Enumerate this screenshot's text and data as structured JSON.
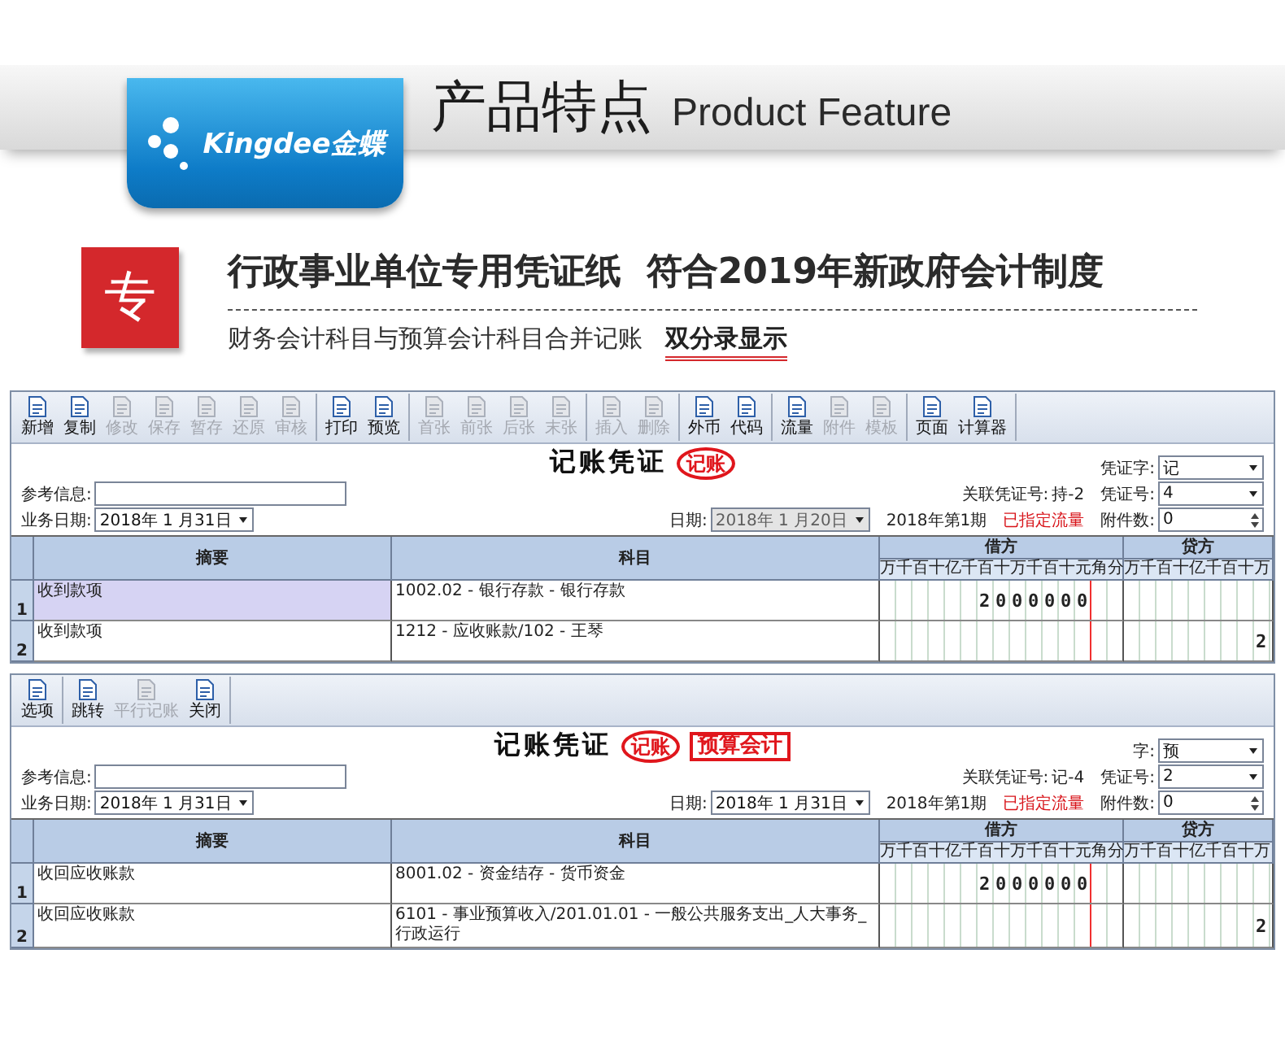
{
  "banner": {
    "logo": "Kingdee金蝶",
    "title": "产品特点",
    "subtitle": "Product Feature"
  },
  "feature": {
    "badge": "专",
    "heading": "行政事业单位专用凭证纸  符合2019年新政府会计制度",
    "description": "财务会计科目与预算会计科目合并记账",
    "highlight": "双分录显示"
  },
  "panes": [
    {
      "toolbar": [
        [
          {
            "label": "新增",
            "disabled": false
          },
          {
            "label": "复制",
            "disabled": false
          },
          {
            "label": "修改",
            "disabled": true
          },
          {
            "label": "保存",
            "disabled": true
          },
          {
            "label": "暂存",
            "disabled": true
          },
          {
            "label": "还原",
            "disabled": true
          },
          {
            "label": "审核",
            "disabled": true
          }
        ],
        [
          {
            "label": "打印",
            "disabled": false
          },
          {
            "label": "预览",
            "disabled": false
          }
        ],
        [
          {
            "label": "首张",
            "disabled": true
          },
          {
            "label": "前张",
            "disabled": true
          },
          {
            "label": "后张",
            "disabled": true
          },
          {
            "label": "末张",
            "disabled": true
          }
        ],
        [
          {
            "label": "插入",
            "disabled": true
          },
          {
            "label": "删除",
            "disabled": true
          }
        ],
        [
          {
            "label": "外币",
            "disabled": false
          },
          {
            "label": "代码",
            "disabled": false
          }
        ],
        [
          {
            "label": "流量",
            "disabled": false
          },
          {
            "label": "附件",
            "disabled": true
          },
          {
            "label": "模板",
            "disabled": true
          }
        ],
        [
          {
            "label": "页面",
            "disabled": false
          },
          {
            "label": "计算器",
            "disabled": false
          }
        ]
      ],
      "title": "记账凭证",
      "stamps": [
        {
          "text": "记账",
          "kind": "circle"
        }
      ],
      "voucher_type": {
        "label": "凭证字:",
        "value": "记",
        "kind": "dropdown",
        "disabled": false
      },
      "reference": {
        "label": "参考信息:",
        "kind": "text",
        "disabled": false
      },
      "related": {
        "label": "关联凭证号:",
        "value": "持-2"
      },
      "number": {
        "label": "凭证号:",
        "value": "4",
        "kind": "dropdown",
        "disabled": false
      },
      "business_date": {
        "label": "业务日期:",
        "value": "2018年 1 月31日",
        "kind": "dropdown",
        "disabled": false
      },
      "date": {
        "label": "日期:",
        "value": "2018年 1 月20日",
        "kind": "dropdown",
        "disabled": true
      },
      "period": "2018年第1期",
      "flow_status": "已指定流量",
      "attachments": {
        "label": "附件数:",
        "value": "0",
        "kind": "spin",
        "disabled": false
      },
      "table": {
        "columns": [
          "摘要",
          "科目",
          "借方",
          "贷方"
        ],
        "debit_units": "万千百十亿千百十万千百十元角分",
        "credit_units": "万千百十亿千百十万",
        "rows": [
          {
            "number": "1",
            "summary": "收到款项",
            "account": "1002.02 - 银行存款 - 银行存款",
            "debit": "2000000",
            "selected": true
          },
          {
            "number": "2",
            "summary": "收到款项",
            "account": "1212 - 应收账款/102 - 王琴",
            "credit": "2",
            "selected": false
          }
        ]
      }
    },
    {
      "toolbar": [
        [
          {
            "label": "选项",
            "disabled": false
          }
        ],
        [
          {
            "label": "跳转",
            "disabled": false
          },
          {
            "label": "平行记账",
            "disabled": true
          },
          {
            "label": "关闭",
            "disabled": false
          }
        ]
      ],
      "title": "记账凭证",
      "stamps": [
        {
          "text": "记账",
          "kind": "circle"
        },
        {
          "text": "预算会计",
          "kind": "box"
        }
      ],
      "voucher_type": {
        "label": "字:",
        "value": "预",
        "kind": "dropdown",
        "disabled": false
      },
      "reference": {
        "label": "参考信息:",
        "kind": "text",
        "disabled": false
      },
      "related": {
        "label": "关联凭证号:",
        "value": "记-4"
      },
      "number": {
        "label": "凭证号:",
        "value": "2",
        "kind": "dropdown",
        "disabled": false
      },
      "business_date": {
        "label": "业务日期:",
        "value": "2018年 1 月31日",
        "kind": "dropdown",
        "disabled": false
      },
      "date": {
        "label": "日期:",
        "value": "2018年 1 月31日",
        "kind": "dropdown",
        "disabled": false
      },
      "period": "2018年第1期",
      "flow_status": "已指定流量",
      "attachments": {
        "label": "附件数:",
        "value": "0",
        "kind": "spin",
        "disabled": false
      },
      "table": {
        "columns": [
          "摘要",
          "科目",
          "借方",
          "贷方"
        ],
        "debit_units": "万千百十亿千百十万千百十元角分",
        "credit_units": "万千百十亿千百十万",
        "rows": [
          {
            "number": "1",
            "summary": "收回应收账款",
            "account": "8001.02 - 资金结存 - 货币资金",
            "debit": "2000000",
            "selected": false
          },
          {
            "number": "2",
            "summary": "收回应收账款",
            "account": "6101 - 事业预算收入/201.01.01 - 一般公共服务支出_人大事务_行政运行",
            "credit": "2",
            "selected": false
          }
        ]
      }
    }
  ]
}
